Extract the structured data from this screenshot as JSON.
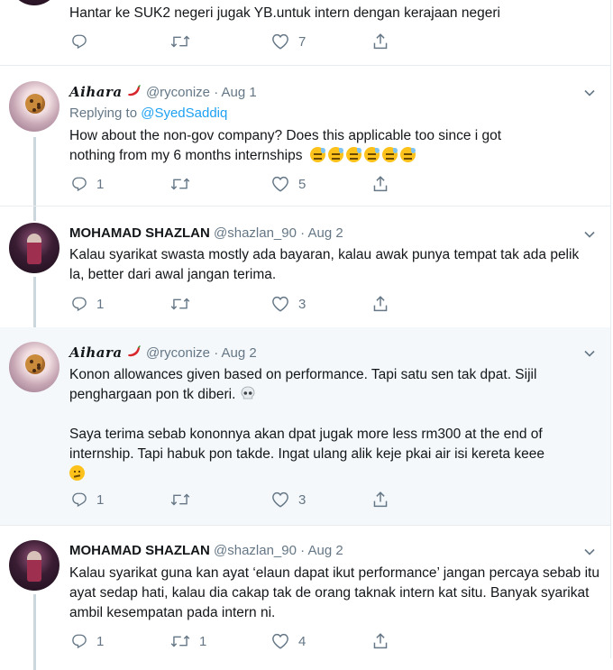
{
  "tweets": [
    {
      "text": "Hantar ke SUK2 negeri jugak YB.untuk intern dengan kerajaan negeri",
      "reply_count": "",
      "retweet_count": "",
      "like_count": "7"
    },
    {
      "name": "Aihara",
      "handle": "@ryconize",
      "date": "· Aug 1",
      "replying_label": "Replying to",
      "replying_to": "@SyedSaddiq",
      "text1": "How about the non-gov company? Does this applicable too since i got",
      "text2": "nothing from my 6 months internships",
      "reply_count": "1",
      "retweet_count": "",
      "like_count": "5"
    },
    {
      "name": "MOHAMAD SHAZLAN",
      "handle": "@shazlan_90",
      "date": "· Aug 2",
      "text": "Kalau syarikat swasta mostly ada bayaran, kalau awak punya tempat tak ada pelik la, better dari awal jangan terima.",
      "reply_count": "1",
      "retweet_count": "",
      "like_count": "3"
    },
    {
      "name": "Aihara",
      "handle": "@ryconize",
      "date": "· Aug 2",
      "text1": "Konon allowances given based on performance. Tapi satu sen tak dpat. Sijil penghargaan pon tk diberi.",
      "text2": "Saya terima sebab kononnya akan dpat jugak more less rm300 at the end of internship. Tapi habuk pon takde. Ingat ulang alik keje pkai air isi kereta keee",
      "reply_count": "1",
      "retweet_count": "",
      "like_count": "3"
    },
    {
      "name": "MOHAMAD SHAZLAN",
      "handle": "@shazlan_90",
      "date": "· Aug 2",
      "text": "Kalau syarikat guna kan ayat ‘elaun dapat ikut performance’ jangan percaya sebab itu ayat sedap hati, kalau dia cakap tak de orang taknak intern kat situ. Banyak syarikat ambil kesempatan pada intern ni.",
      "reply_count": "1",
      "retweet_count": "1",
      "like_count": "4"
    }
  ],
  "icons": [
    "reply-icon",
    "retweet-icon",
    "like-icon",
    "share-icon",
    "chevron-down-icon",
    "chili-pepper-emoji",
    "sweat-face-emoji",
    "skull-emoji",
    "confused-face-emoji"
  ]
}
